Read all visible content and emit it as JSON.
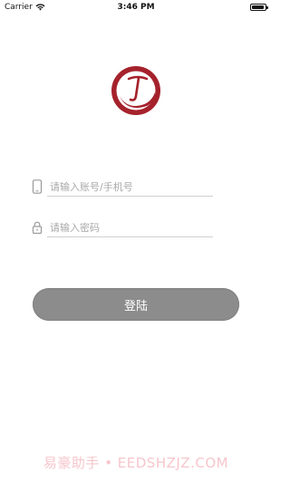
{
  "status_bar": {
    "carrier": "Carrier",
    "time": "3:46 PM",
    "icons": [
      "wifi-icon",
      "battery-icon"
    ]
  },
  "logo": {
    "icon": "app-logo-icon",
    "brand_color": "#a5222c"
  },
  "form": {
    "account": {
      "placeholder": "请输入账号/手机号",
      "value": "",
      "icon": "phone-icon"
    },
    "password": {
      "placeholder": "请输入密码",
      "value": "",
      "icon": "lock-icon"
    }
  },
  "login_button": {
    "label": "登陆",
    "color": "#8c8c8c"
  },
  "watermark": {
    "text": "易豪助手 • EEDSHZJZ.COM"
  }
}
